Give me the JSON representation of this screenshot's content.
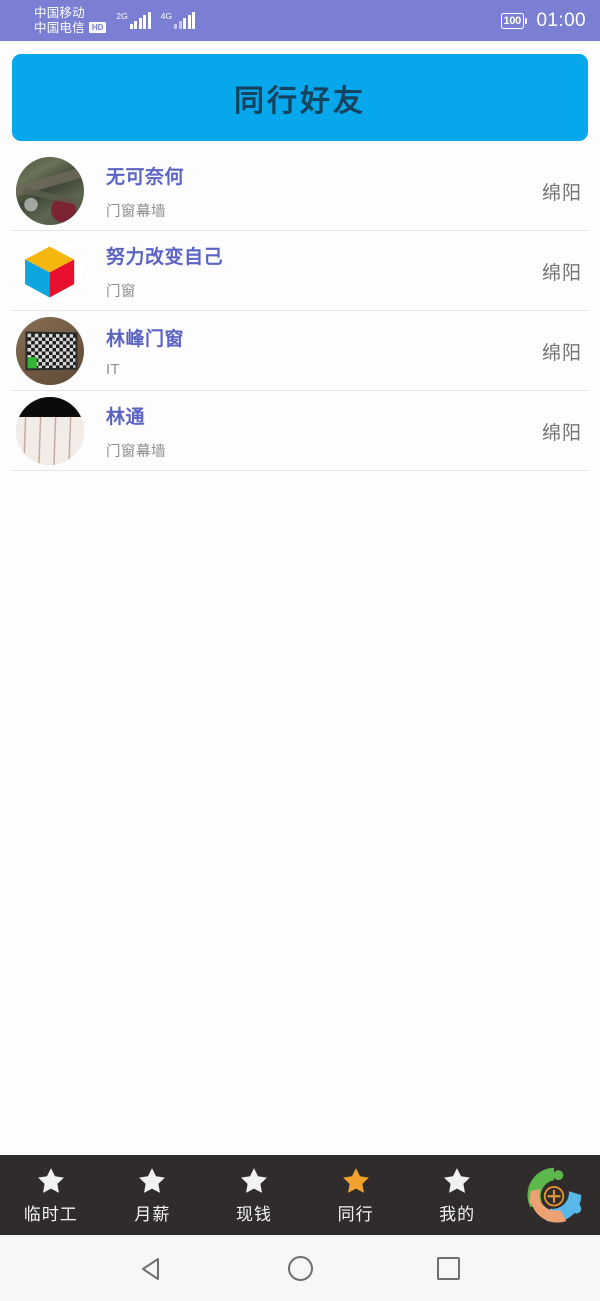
{
  "status_bar": {
    "carrier_primary": "中国移动",
    "carrier_secondary": "中国电信",
    "hd_badge": "HD",
    "signal_1_label": "2G",
    "signal_2_label": "4G",
    "battery_level": "100",
    "time": "01:00"
  },
  "header": {
    "title": "同行好友",
    "background_color": "#07a7ec",
    "title_color": "#14435e"
  },
  "friends": [
    {
      "name": "无可奈何",
      "trade": "门窗幕墙",
      "city": "绵阳",
      "avatar": "outdoor-photo-avatar"
    },
    {
      "name": "努力改变自己",
      "trade": "门窗",
      "city": "绵阳",
      "avatar": "color-cube-avatar"
    },
    {
      "name": "林峰门窗",
      "trade": "IT",
      "city": "绵阳",
      "avatar": "checkerboard-avatar"
    },
    {
      "name": "林通",
      "trade": "门窗幕墙",
      "city": "绵阳",
      "avatar": "keyboard-photo-avatar"
    }
  ],
  "tab_bar": {
    "active_index": 3,
    "active_color": "#f0a22c",
    "inactive_color": "#f2f2f2",
    "items": [
      {
        "label": "临时工",
        "icon": "star-icon"
      },
      {
        "label": "月薪",
        "icon": "star-icon"
      },
      {
        "label": "现钱",
        "icon": "star-icon"
      },
      {
        "label": "同行",
        "icon": "star-icon"
      },
      {
        "label": "我的",
        "icon": "star-icon"
      }
    ],
    "logo": "app-logo-icon"
  },
  "system_nav": {
    "back": "back-triangle-icon",
    "home": "home-circle-icon",
    "recents": "recents-square-icon"
  },
  "colors": {
    "status_bar": "#7b7fd4",
    "name_text": "#5b63c4",
    "trade_text": "#8d8d8d",
    "city_text": "#737373",
    "tabbar_bg": "#2f2c2b"
  }
}
